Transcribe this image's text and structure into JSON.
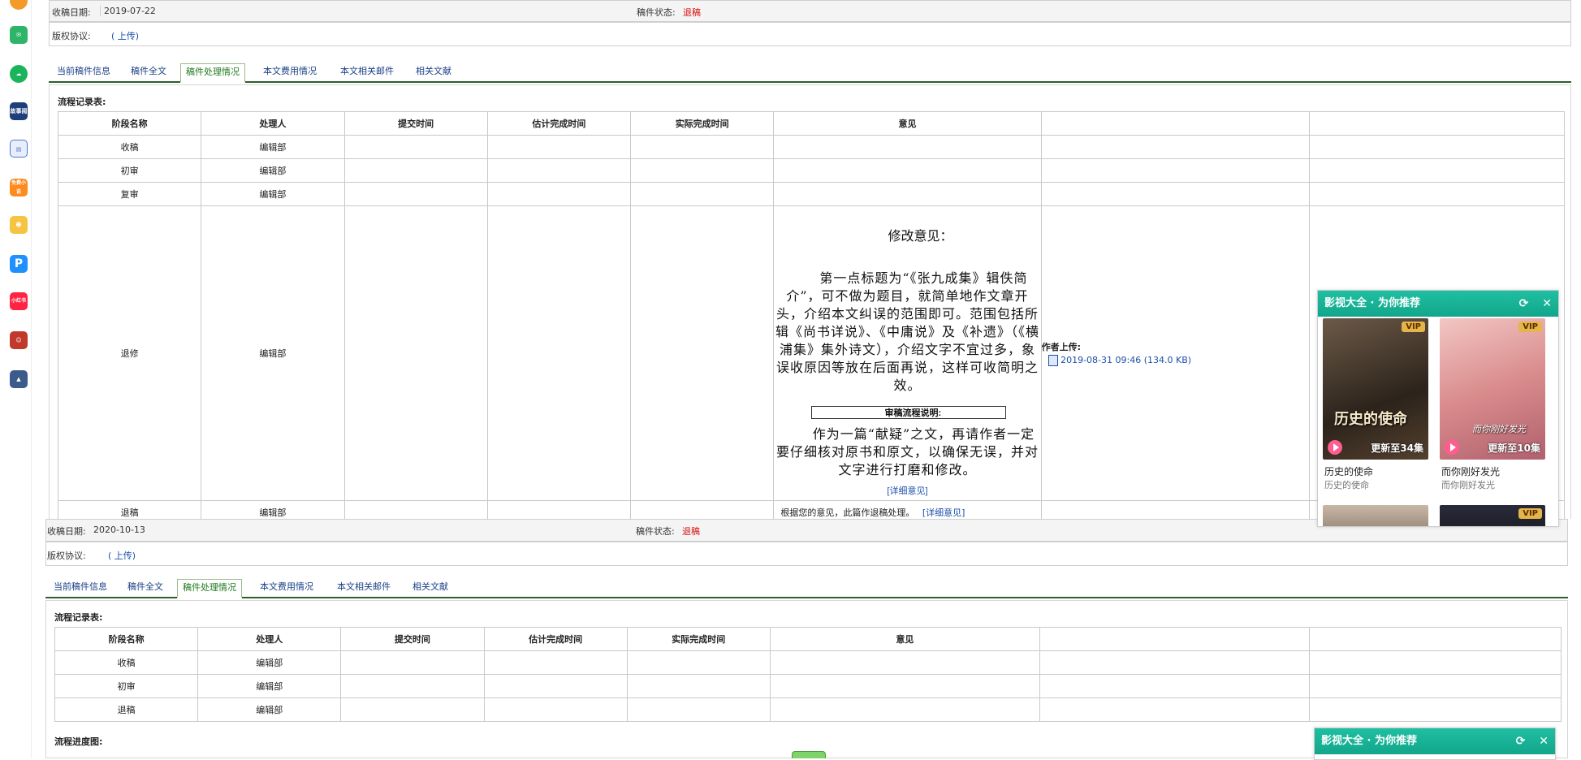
{
  "dock": {
    "icons": [
      "app-icon-orange",
      "mail-icon",
      "cloud-icon",
      "book-icon",
      "document-icon",
      "free-novel-icon",
      "game-icon",
      "p-icon",
      "app-red-icon",
      "game-character-icon",
      "game-scene-icon"
    ],
    "labels": {
      "free_novel": "免费小说",
      "red_app": "小红书",
      "book": "故事阅读"
    }
  },
  "top_section": {
    "received_label": "收稿日期:",
    "received_date": "2019-07-22",
    "status_label": "稿件状态:",
    "status_value": "退稿",
    "copyright_label": "版权协议:",
    "upload_link": "( 上传)",
    "tabs": [
      {
        "label": "当前稿件信息"
      },
      {
        "label": "稿件全文"
      },
      {
        "label": "稿件处理情况"
      },
      {
        "label": "本文费用情况"
      },
      {
        "label": "本文相关邮件"
      },
      {
        "label": "相关文献"
      }
    ],
    "active_tab": "稿件处理情况",
    "flow_title": "流程记录表:",
    "columns": [
      "阶段名称",
      "处理人",
      "提交时间",
      "估计完成时间",
      "实际完成时间",
      "意见",
      "",
      ""
    ],
    "rows": [
      {
        "stage": "收稿",
        "handler": "编辑部"
      },
      {
        "stage": "初审",
        "handler": "编辑部"
      },
      {
        "stage": "复审",
        "handler": "编辑部"
      },
      {
        "stage": "退修",
        "handler": "编辑部"
      },
      {
        "stage": "退稿",
        "handler": "编辑部"
      }
    ],
    "revision_comment": {
      "heading": "修改意见：",
      "para1": "第一点标题为“《张九成集》辑佚简介”，可不做为题目，就简单地作文章开头，介绍本文纠误的范围即可。范围包括所辑《尚书详说》、《中庸说》及《补遗》（《横浦集》集外诗文），介绍文字不宜过多，象误收原因等放在后面再说，这样可收简明之效。",
      "tooltip": "审稿流程说明:",
      "para2": "作为一篇“献疑”之文，再请作者一定要仔细核对原书和原文，以确保无误，并对文字进行打磨和修改。",
      "detail_link": "[详细意见]"
    },
    "author_upload": {
      "label": "作者上传:",
      "file_link": "2019-08-31 09:46 (134.0 KB)"
    },
    "reject_note": "根据您的意见，此篇作退稿处理。",
    "reject_detail_link": "[详细意见]"
  },
  "bottom_section": {
    "received_label": "收稿日期:",
    "received_date": "2020-10-13",
    "status_label": "稿件状态:",
    "status_value": "退稿",
    "copyright_label": "版权协议:",
    "upload_link": "( 上传)",
    "tabs": [
      {
        "label": "当前稿件信息"
      },
      {
        "label": "稿件全文"
      },
      {
        "label": "稿件处理情况"
      },
      {
        "label": "本文费用情况"
      },
      {
        "label": "本文相关邮件"
      },
      {
        "label": "相关文献"
      }
    ],
    "active_tab": "稿件处理情况",
    "flow_title": "流程记录表:",
    "columns": [
      "阶段名称",
      "处理人",
      "提交时间",
      "估计完成时间",
      "实际完成时间",
      "意见",
      "",
      ""
    ],
    "rows": [
      {
        "stage": "收稿",
        "handler": "编辑部"
      },
      {
        "stage": "初审",
        "handler": "编辑部"
      },
      {
        "stage": "退稿",
        "handler": "编辑部"
      }
    ],
    "progress_title": "流程进度图:"
  },
  "popup_top": {
    "title": "影视大全 · 为你推荐",
    "refresh_icon": "refresh-icon",
    "close_icon": "close-icon",
    "items": [
      {
        "title": "历史的使命",
        "subtitle": "历史的使命",
        "badge": "VIP",
        "update": "更新至34集",
        "poster_title": "历史的使命"
      },
      {
        "title": "而你刚好发光",
        "subtitle": "而你刚好发光",
        "badge": "VIP",
        "update": "更新至10集",
        "poster_title": "而你刚好发光"
      }
    ],
    "more_badge": "VIP"
  },
  "popup_bottom": {
    "title": "影视大全 · 为你推荐"
  },
  "colors": {
    "status_red": "#d81010",
    "tab_link": "#1a3f86",
    "active_tab": "#1e7a1e",
    "popup_header": "#17b396"
  }
}
